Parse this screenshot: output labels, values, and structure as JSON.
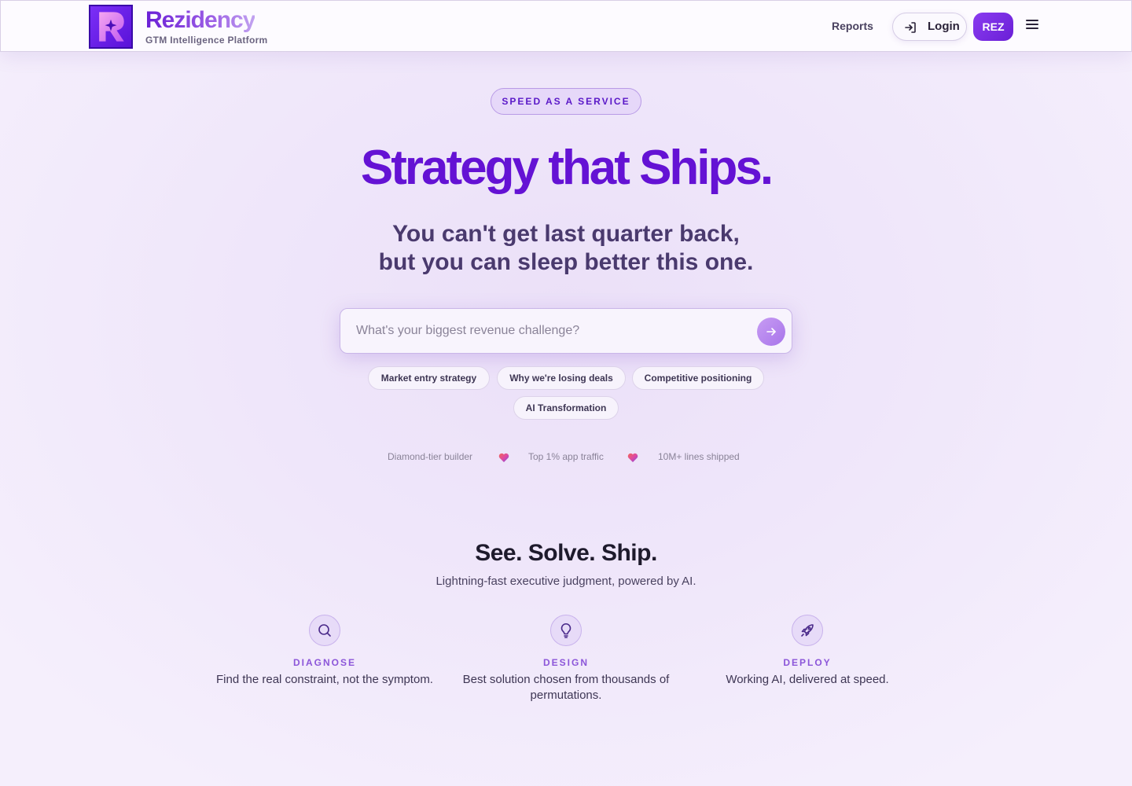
{
  "header": {
    "brand_name": "Rezidency",
    "brand_sub": "GTM Intelligence Platform",
    "logo_icon": "sparkle-r-logo",
    "reports_label": "Reports",
    "login_label": "Login",
    "login_icon": "login-arrow-icon",
    "rez_label": "REZ",
    "menu_icon": "hamburger-menu-icon"
  },
  "hero": {
    "badge": "SPEED AS A SERVICE",
    "title": "Strategy that Ships.",
    "subtitle_line1": "You can't get last quarter back,",
    "subtitle_line2": "but you can sleep better this one.",
    "search_placeholder": "What's your biggest revenue challenge?",
    "search_value": "",
    "submit_icon": "arrow-right-icon",
    "chips": [
      "Market entry strategy",
      "Why we're losing deals",
      "Competitive positioning",
      "AI Transformation"
    ],
    "stats": [
      "Diamond-tier builder",
      "Top 1% app traffic",
      "10M+ lines shipped"
    ],
    "stat_separator_icon": "heart-gradient-icon"
  },
  "section": {
    "title": "See. Solve. Ship.",
    "subtitle": "Lightning-fast executive judgment, powered by AI.",
    "features": [
      {
        "icon": "search-icon",
        "label": "DIAGNOSE",
        "description": "Find the real constraint, not the symptom."
      },
      {
        "icon": "lightbulb-icon",
        "label": "DESIGN",
        "description": "Best solution chosen from thousands of permutations."
      },
      {
        "icon": "rocket-icon",
        "label": "DEPLOY",
        "description": "Working AI, delivered at speed."
      }
    ]
  },
  "colors": {
    "accent": "#6412d4",
    "accent_light": "#8c56d9",
    "background": "#efe6fa",
    "header_bg": "#fdfbff"
  }
}
